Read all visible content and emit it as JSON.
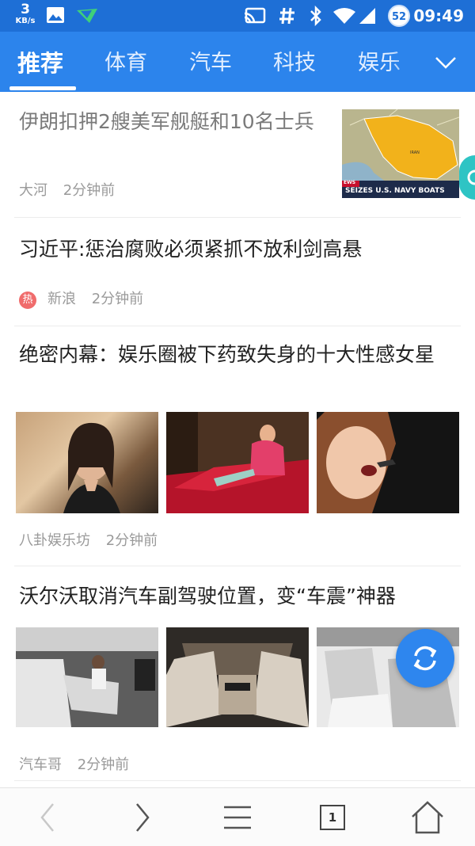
{
  "status_bar": {
    "net_speed_value": "3",
    "net_speed_unit": "KB/s",
    "battery_level": "52",
    "time": "09:49",
    "icons": [
      "gallery-icon",
      "app-notification-icon",
      "cast-icon",
      "hash-icon",
      "bluetooth-icon",
      "wifi-icon",
      "signal-icon",
      "battery-icon"
    ]
  },
  "tabs": [
    {
      "label": "推荐",
      "active": true
    },
    {
      "label": "体育",
      "active": false
    },
    {
      "label": "汽车",
      "active": false
    },
    {
      "label": "科技",
      "active": false
    },
    {
      "label": "娱乐",
      "active": false
    }
  ],
  "articles": [
    {
      "title": "伊朗扣押2艘美军舰艇和10名士兵",
      "source": "大河",
      "time": "2分钟前",
      "read": true,
      "thumb_caption": "SEIZES U.S. NAVY BOATS",
      "thumb_tag": "EWS",
      "thumb_map_label": "IRAN"
    },
    {
      "title": "习近平:惩治腐败必须紧抓不放利剑高悬",
      "source": "新浪",
      "time": "2分钟前",
      "hot_badge": "热",
      "read": false
    },
    {
      "title": "绝密内幕：娱乐圈被下药致失身的十大性感女星",
      "source": "八卦娱乐坊",
      "time": "2分钟前",
      "read": false
    },
    {
      "title": "沃尔沃取消汽车副驾驶位置，变“车震”神器",
      "source": "汽车哥",
      "time": "2分钟前",
      "read": false
    }
  ],
  "bottom_nav": {
    "tab_count": "1",
    "icons": [
      "back-icon",
      "forward-icon",
      "menu-icon",
      "tabs-icon",
      "home-icon"
    ]
  },
  "colors": {
    "status_bar": "#1e6fd6",
    "tab_bar": "#2c84ec",
    "fab": "#2e86ee",
    "hot_badge": "#f06c6c"
  }
}
